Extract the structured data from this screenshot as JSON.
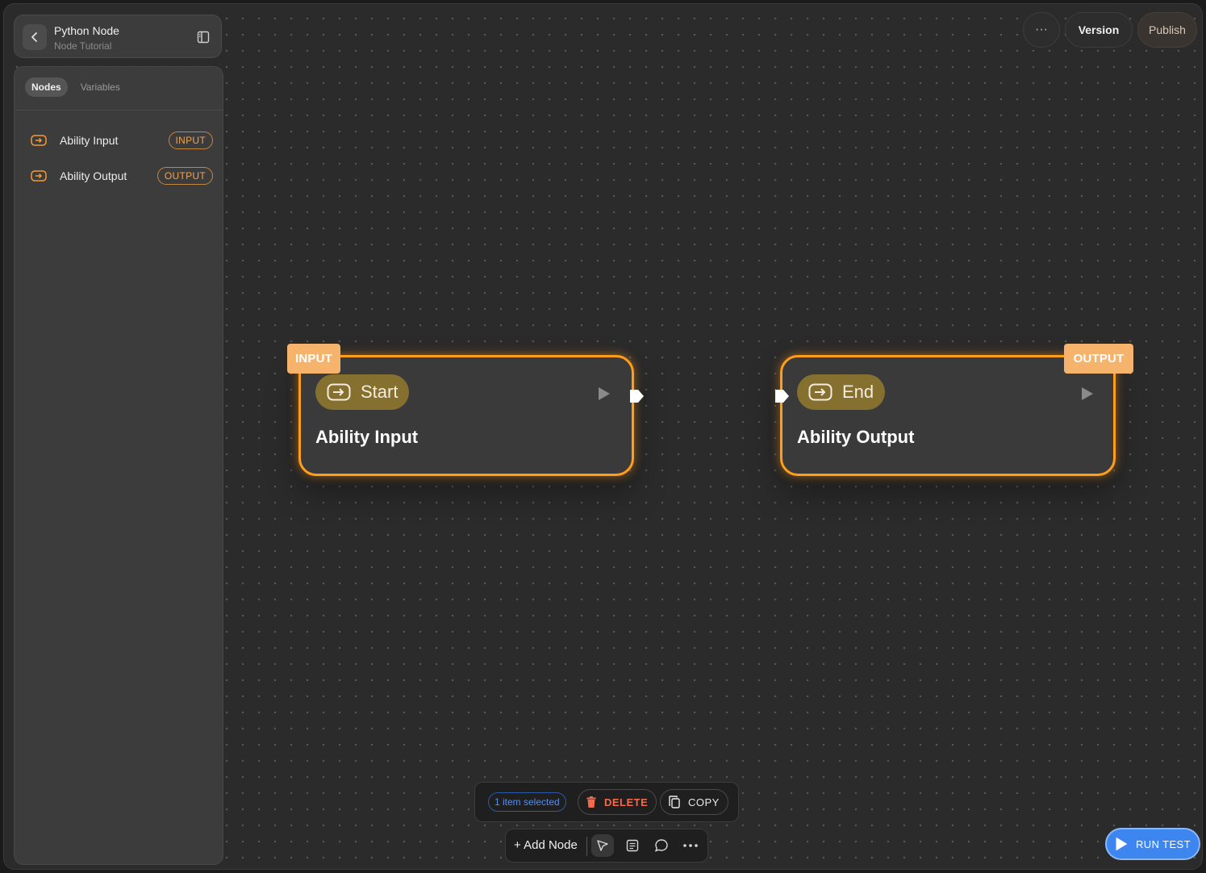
{
  "header": {
    "title": "Python Node",
    "subtitle": "Node Tutorial"
  },
  "sidebar": {
    "tabs": [
      {
        "label": "Nodes",
        "active": true
      },
      {
        "label": "Variables",
        "active": false
      }
    ],
    "items": [
      {
        "label": "Ability Input",
        "badge": "INPUT",
        "icon": "node-entry-icon"
      },
      {
        "label": "Ability Output",
        "badge": "OUTPUT",
        "icon": "node-entry-icon"
      }
    ]
  },
  "topbar": {
    "more_label": "···",
    "version_label": "Version",
    "publish_label": "Publish"
  },
  "nodes": [
    {
      "tag": "INPUT",
      "pill": "Start",
      "title": "Ability Input"
    },
    {
      "tag": "OUTPUT",
      "pill": "End",
      "title": "Ability Output"
    }
  ],
  "selection": {
    "count_label": "1 item selected",
    "delete_label": "DELETE",
    "copy_label": "COPY"
  },
  "toolbar": {
    "add_node_label": "+ Add Node"
  },
  "run_test_label": "RUN TEST",
  "colors": {
    "accent": "#ff9d1c",
    "tag": "#f6b36c",
    "pill": "#857030",
    "run": "#3d86f0",
    "delete": "#f46a4a"
  }
}
